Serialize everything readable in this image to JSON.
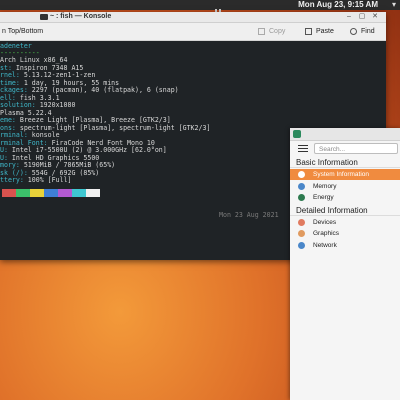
{
  "top_panel": {
    "clock": "Mon Aug 23, 9:15 AM"
  },
  "konsole": {
    "title": "~ : fish — Konsole",
    "toolbar": {
      "left_label": "n Top/Bottom",
      "copy": "Copy",
      "paste": "Paste",
      "find": "Find"
    },
    "terminal": {
      "prompt": "adeneter",
      "separator": "----------",
      "lines": [
        {
          "k": "",
          "v": "Arch Linux x86_64"
        },
        {
          "k": "st: ",
          "v": "Inspiron 7348 A15"
        },
        {
          "k": "rnel: ",
          "v": "5.13.12-zen1-1-zen"
        },
        {
          "k": "time: ",
          "v": "1 day, 19 hours, 55 mins"
        },
        {
          "k": "ckages: ",
          "v": "2297 (pacman), 40 (flatpak), 6 (snap)"
        },
        {
          "k": "ell: ",
          "v": "fish 3.3.1"
        },
        {
          "k": "solution: ",
          "v": "1920x1080"
        },
        {
          "k": "",
          "v": "Plasma 5.22.4"
        },
        {
          "k": "eme: ",
          "v": "Breeze Light [Plasma], Breeze [GTK2/3]"
        },
        {
          "k": "ons: ",
          "v": "spectrum-light [Plasma], spectrum-light [GTK2/3]"
        },
        {
          "k": "rminal: ",
          "v": "konsole"
        },
        {
          "k": "rminal Font: ",
          "v": "FiraCode Nerd Font Mono 10"
        },
        {
          "k": "U: ",
          "v": "Intel i7-5500U (2) @ 3.000GHz [62.0°on]"
        },
        {
          "k": "U: ",
          "v": "Intel HD Graphics 5500"
        },
        {
          "k": "mory: ",
          "v": "5190MiB / 7865MiB (65%)"
        },
        {
          "k": "sk (/): ",
          "v": "554G / 692G (85%)"
        },
        {
          "k": "ttery: ",
          "v": "100% [Full]"
        }
      ],
      "timestamp": "Mon 23 Aug 2021",
      "palette": [
        "#d9534f",
        "#3cc06a",
        "#e8d23a",
        "#3f7fd6",
        "#b35ad1",
        "#3fc7d1",
        "#f0f0f0"
      ]
    }
  },
  "info_center": {
    "search_placeholder": "Search...",
    "sections": [
      {
        "title": "Basic Information",
        "items": [
          {
            "label": "System Information",
            "icon": "system-info-icon",
            "color": "#ffffff",
            "selected": true
          },
          {
            "label": "Memory",
            "icon": "memory-icon",
            "color": "#4a87c9",
            "selected": false
          },
          {
            "label": "Energy",
            "icon": "energy-icon",
            "color": "#2d7a4f",
            "selected": false
          }
        ]
      },
      {
        "title": "Detailed Information",
        "items": [
          {
            "label": "Devices",
            "icon": "devices-icon",
            "color": "#e07a5f",
            "selected": false
          },
          {
            "label": "Graphics",
            "icon": "graphics-icon",
            "color": "#e09a5f",
            "selected": false
          },
          {
            "label": "Network",
            "icon": "network-icon",
            "color": "#4a87c9",
            "selected": false
          }
        ]
      }
    ]
  }
}
